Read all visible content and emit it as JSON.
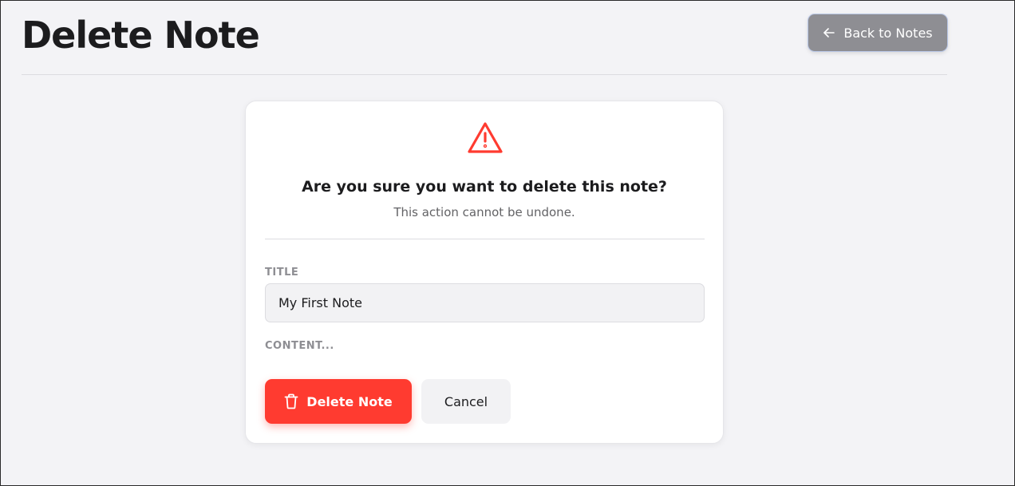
{
  "header": {
    "title": "Delete Note",
    "back_label": "Back to Notes"
  },
  "confirm": {
    "question": "Are you sure you want to delete this note?",
    "warning": "This action cannot be undone."
  },
  "note": {
    "title_label": "TITLE",
    "title_value": "My First Note",
    "content_label": "CONTENT..."
  },
  "actions": {
    "delete_label": "Delete Note",
    "cancel_label": "Cancel"
  },
  "icons": {
    "back": "arrow-left-icon",
    "warning": "warning-triangle-icon",
    "delete": "trash-icon"
  },
  "colors": {
    "danger": "#ff3b30",
    "secondary_button": "#8e8e93",
    "background": "#f3f3f6"
  }
}
